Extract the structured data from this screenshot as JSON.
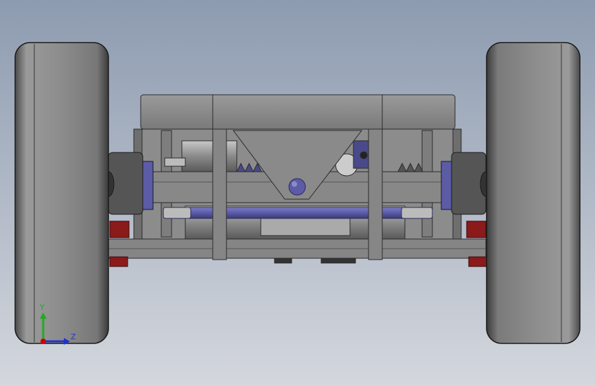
{
  "colors": {
    "background_top": "#8d9bb0",
    "background_bottom": "#d4d7dd",
    "tire": "#8a8a8a",
    "frame": "#808080",
    "frame_edge": "#2a2a2a",
    "axle_blue": "#5b5ba6",
    "brake_red": "#8b1a1a",
    "axis_x": "#cc0000",
    "axis_y": "#22aa22",
    "axis_z": "#2233cc"
  },
  "triad": {
    "y_label": "Y",
    "z_label": "Z"
  }
}
